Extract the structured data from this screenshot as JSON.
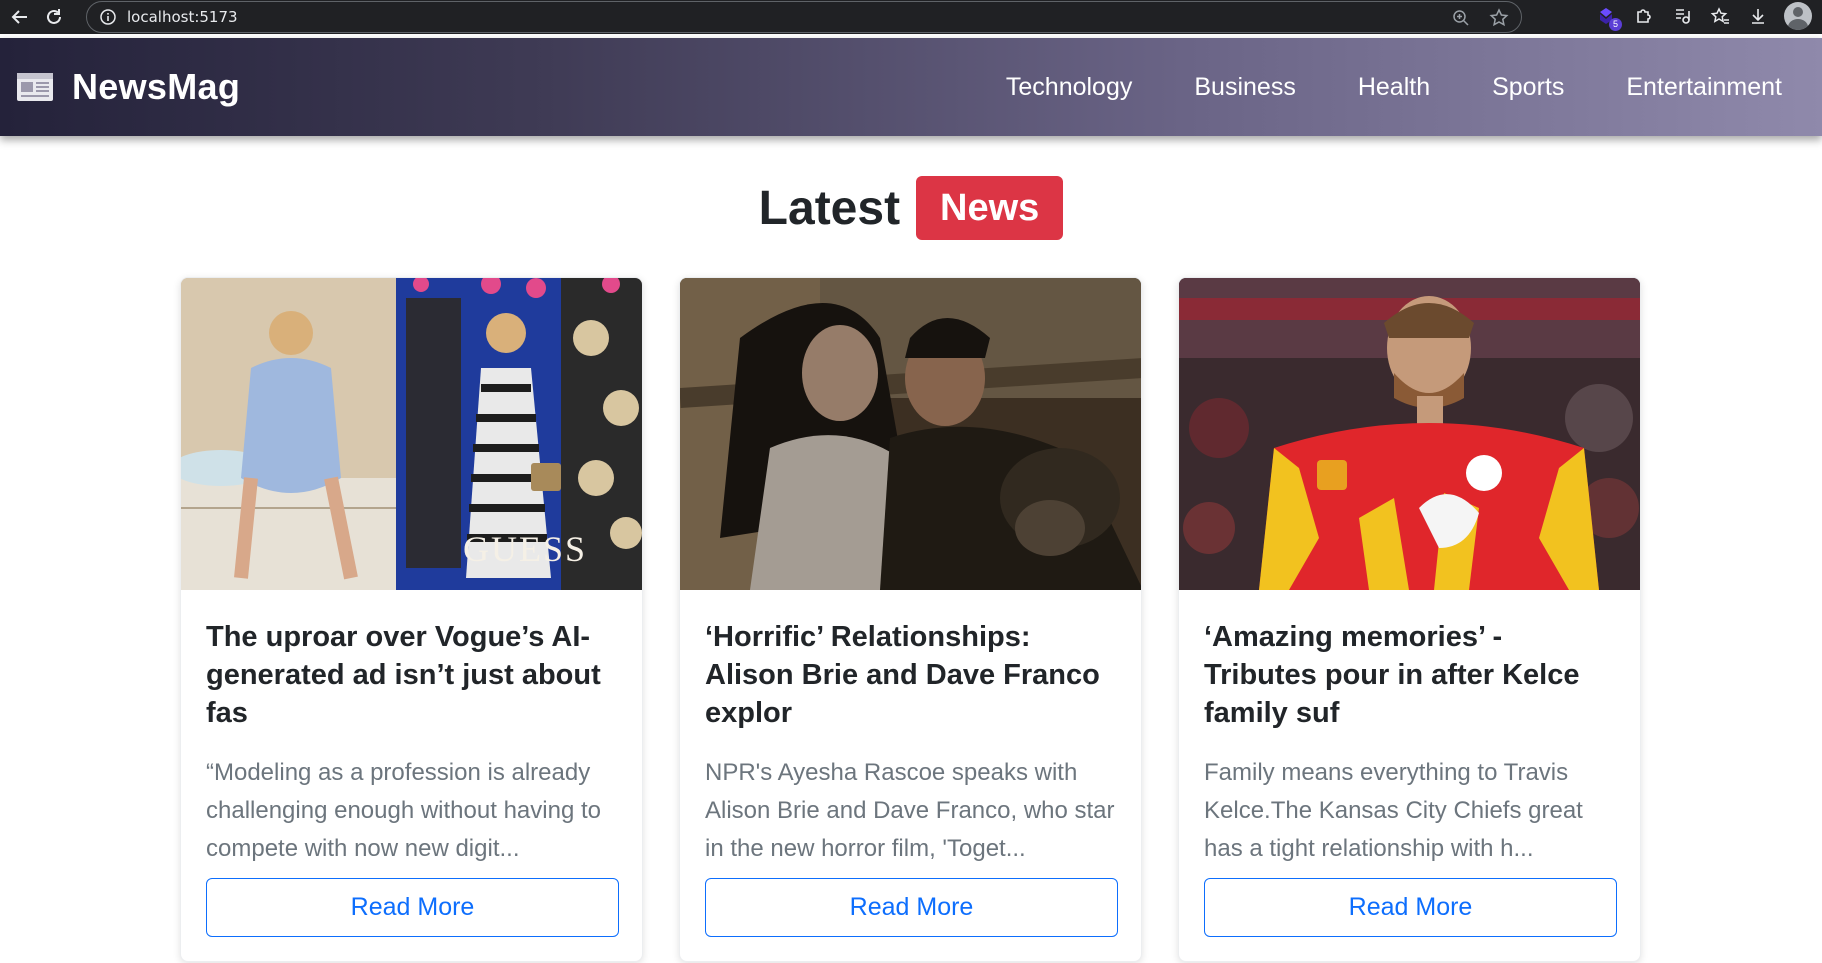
{
  "browser": {
    "url": "localhost:5173",
    "extension_badge": "5"
  },
  "navbar": {
    "brand": "NewsMag",
    "links": [
      "Technology",
      "Business",
      "Health",
      "Sports",
      "Entertainment"
    ]
  },
  "heading": {
    "text": "Latest",
    "badge": "News"
  },
  "articles": [
    {
      "title": "The uproar over Vogue’s AI-generated ad isn’t just about fas",
      "description": "“Modeling as a profession is already challenging enough without having to compete with now new digit...",
      "button": "Read More",
      "image_overlay_text": "GUESS"
    },
    {
      "title": "‘Horrific’ Relationships: Alison Brie and Dave Franco explor",
      "description": "NPR's Ayesha Rascoe speaks with Alison Brie and Dave Franco, who star in the new horror film, 'Toget...",
      "button": "Read More"
    },
    {
      "title": "‘Amazing memories’ - Tributes pour in after Kelce family suf",
      "description": "Family means everything to Travis Kelce.The Kansas City Chiefs great has a tight relationship with h...",
      "button": "Read More"
    }
  ]
}
